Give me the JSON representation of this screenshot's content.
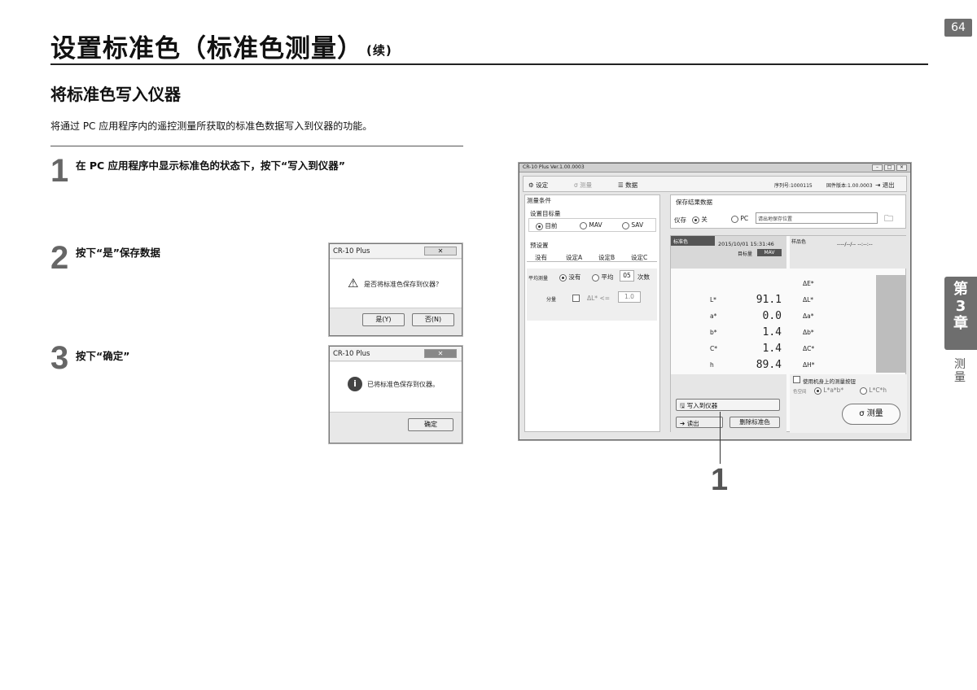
{
  "page_number": "64",
  "title": "设置标准色（标准色测量）",
  "title_cont": "(续)",
  "subtitle": "将标准色写入仪器",
  "intro": "将通过 PC 应用程序内的遥控测量所获取的标准色数据写入到仪器的功能。",
  "steps": [
    {
      "num": "1",
      "text": "在 PC 应用程序中显示标准色的状态下，按下“写入到仪器”"
    },
    {
      "num": "2",
      "text": "按下“是”保存数据"
    },
    {
      "num": "3",
      "text": "按下“确定”"
    }
  ],
  "chapter": {
    "line1": "第",
    "line2": "3",
    "line3": "章",
    "sub1": "测",
    "sub2": "量"
  },
  "dialog1": {
    "title": "CR-10 Plus",
    "message": "是否将标准色保存到仪器？",
    "yes": "是(Y)",
    "no": "否(N)"
  },
  "dialog2": {
    "title": "CR-10 Plus",
    "message": "已将标准色保存到仪器。",
    "ok": "确定"
  },
  "app": {
    "window_title": "CR-10 Plus Ver.1.00.0003",
    "tab_settings": "设定",
    "tab_measure": "测量",
    "tab_data": "数据",
    "serial": "序列号:1000115",
    "firmware": "固件版本:1.00.0003",
    "exit": "退出",
    "measure_conditions": "测量条件",
    "target_label": "设置目标量",
    "target_opts": [
      "目前",
      "MAV",
      "SAV"
    ],
    "save_results": "保存结果数据",
    "instrument": "仪存",
    "instrument_off": "关",
    "pc": "PC",
    "save_path": "请出地保存位置",
    "presets": "预设置",
    "preset_tabs": [
      "没有",
      "设定A",
      "设定B",
      "设定C"
    ],
    "avg_label": "平均测量",
    "avg_none": "没有",
    "avg_on": "平均",
    "avg_count": "05",
    "avg_unit": "次数",
    "tol_label": "分量",
    "tol_cond": "ΔL* <=",
    "tol_value": "1.0",
    "std_label": "标准色",
    "std_date": "2015/10/01 15:31:46",
    "std_mode_label": "目标量",
    "std_mode": "MAV",
    "sample_label": "样品色",
    "sample_date": "----/--/-- --:--:--",
    "rows": [
      {
        "name": "L*",
        "value": "91.1",
        "delta": "ΔL*"
      },
      {
        "name": "a*",
        "value": "0.0",
        "delta": "Δa*"
      },
      {
        "name": "b*",
        "value": "1.4",
        "delta": "Δb*"
      },
      {
        "name": "C*",
        "value": "1.4",
        "delta": "ΔC*"
      },
      {
        "name": "h",
        "value": "89.4",
        "delta": "ΔH*"
      }
    ],
    "de_label": "ΔE*",
    "write_button": "写入到仪器",
    "read_button": "读出",
    "delete_button": "删除标准色",
    "use_instr": "使用机身上的测量按钮",
    "color_space": "色空间",
    "cs_opt1": "L*a*b*",
    "cs_opt2": "L*C*h",
    "measure_button": "测量"
  },
  "callout": "1"
}
